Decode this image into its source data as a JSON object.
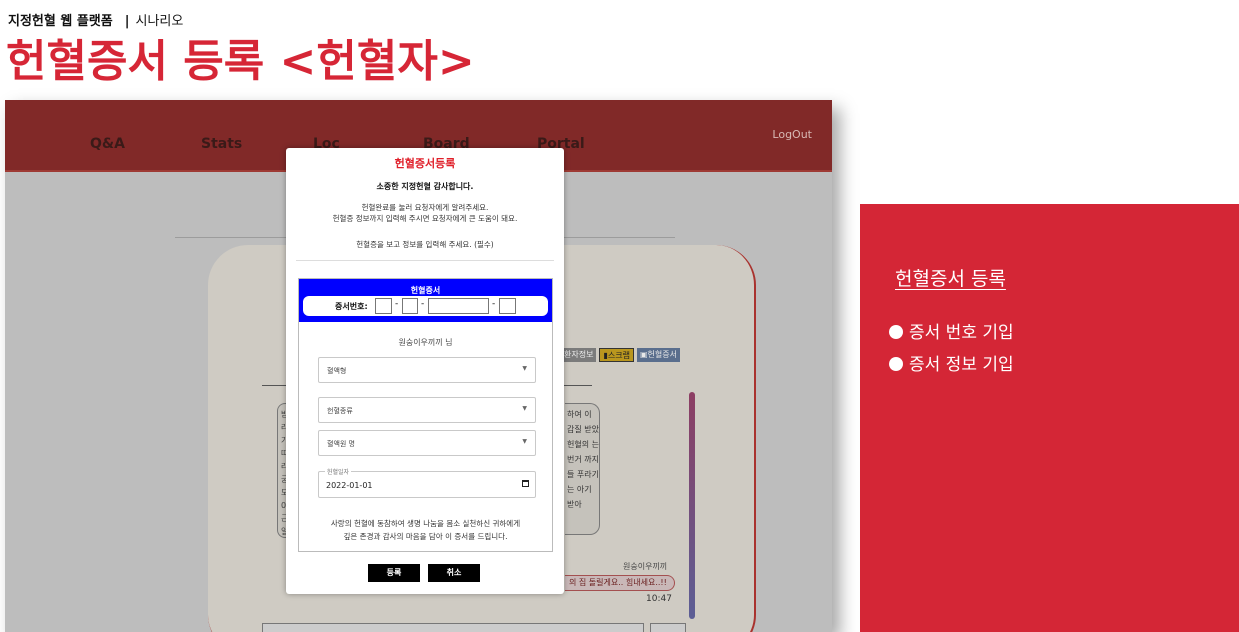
{
  "header": {
    "breadcrumb_platform": "지정헌혈 웹 플랫폼",
    "breadcrumb_separator": "|",
    "breadcrumb_section": "시나리오",
    "title": "헌혈증서 등록 <헌혈자>"
  },
  "nav": {
    "items": [
      "Q&A",
      "Stats",
      "Loc",
      "Board",
      "Portal"
    ],
    "logout": "LogOut"
  },
  "chat": {
    "chips": [
      "환자정보",
      "스크랩",
      "헌혈증서"
    ],
    "left_fragment": "받 라 가 따 라 궁 모 0 근 일 0 1",
    "right_fragment": "하여 이 갑질 받았 헌혈의 는 번거 까지 들 푸라기 는 아기 받아",
    "sender": "원숭이우끼끼",
    "message": "의 집 돌릴게요.. 힘내세요..!!",
    "time": "10:47"
  },
  "modal": {
    "title": "헌혈증서등록",
    "thanks": "소중한 지정헌혈 감사합니다.",
    "desc_line1": "헌혈완료를 눌러 요청자에게 알려주세요.",
    "desc_line2": "헌혈증 정보까지 입력해 주시면 요청자에게 큰 도움이 돼요.",
    "note": "헌혈증을 보고 정보를 입력해 주세요. (필수)",
    "cert_title": "헌혈증서",
    "number_label": "증서번호:",
    "owner": "원숭이우끼끼 님",
    "blood_type_placeholder": "혈액형",
    "donation_type_placeholder": "헌혈종류",
    "center_placeholder": "혈액원 명",
    "date_label": "헌혈일자",
    "date_value": "2022-01-01",
    "footer_line1": "사랑의 헌혈에 동참하여 생명 나눔을 몸소 실천하신 귀하에게",
    "footer_line2": "깊은 존경과 감사의 마음을 담아 이 증서를 드립니다.",
    "register_button": "등록",
    "cancel_button": "취소"
  },
  "panel": {
    "title": "헌혈증서 등록",
    "items": [
      "증서 번호 기입",
      "증서 정보 기입"
    ]
  },
  "colors": {
    "accent_red": "#d42636",
    "nav_bar": "#812928",
    "cert_header": "#0000ff"
  }
}
